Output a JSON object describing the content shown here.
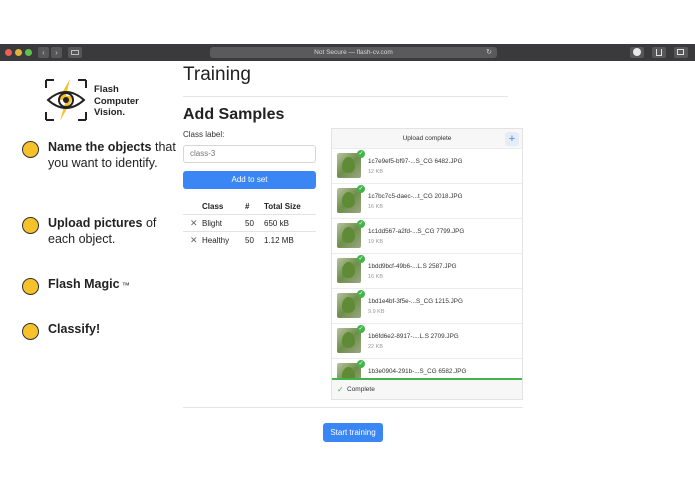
{
  "browser": {
    "address": "Not Secure — flash-cv.com"
  },
  "logo": {
    "line1": "Flash",
    "line2": "Computer",
    "line3": "Vision."
  },
  "steps": [
    {
      "bold": "Name the objects",
      "rest": " that you want to identify."
    },
    {
      "bold": "Upload pictures",
      "rest": " of each object."
    },
    {
      "bold": "Flash Magic",
      "rest": " ™"
    },
    {
      "bold": "Classify!",
      "rest": ""
    }
  ],
  "main": {
    "title": "Training",
    "section_title": "Add Samples",
    "class_label": "Class label:",
    "class_input_value": "class-3",
    "add_button": "Add to set",
    "table": {
      "headers": [
        "Class",
        "#",
        "Total Size"
      ],
      "rows": [
        {
          "class": "Blight",
          "count": "50",
          "size": "650 kB"
        },
        {
          "class": "Healthy",
          "count": "50",
          "size": "1.12 MB"
        }
      ]
    },
    "start_button": "Start training"
  },
  "upload": {
    "header": "Upload complete",
    "add_icon": "+",
    "files": [
      {
        "name": "1c7e9ef5-bf97-...S_CG 6482.JPG",
        "size": "12 KB"
      },
      {
        "name": "1c7bc7c5-daec-...t_CG 2018.JPG",
        "size": "16 KB"
      },
      {
        "name": "1c1dd567-a2fd-...S_CG 7799.JPG",
        "size": "19 KB"
      },
      {
        "name": "1bdd9bcf-49b6-...L.S 2587.JPG",
        "size": "16 KB"
      },
      {
        "name": "1bd1e4bf-3f5e-...S_CG 1215.JPG",
        "size": "9.9 KB"
      },
      {
        "name": "1b6fd6e2-8917-....L.S 2709.JPG",
        "size": "22 KB"
      },
      {
        "name": "1b3e0904-291b-...S_CG 6582.JPG",
        "size": ""
      }
    ],
    "status": "Complete"
  },
  "colors": {
    "accent": "#3a86f5",
    "step_dot": "#f7c12a",
    "success": "#43b34a"
  }
}
